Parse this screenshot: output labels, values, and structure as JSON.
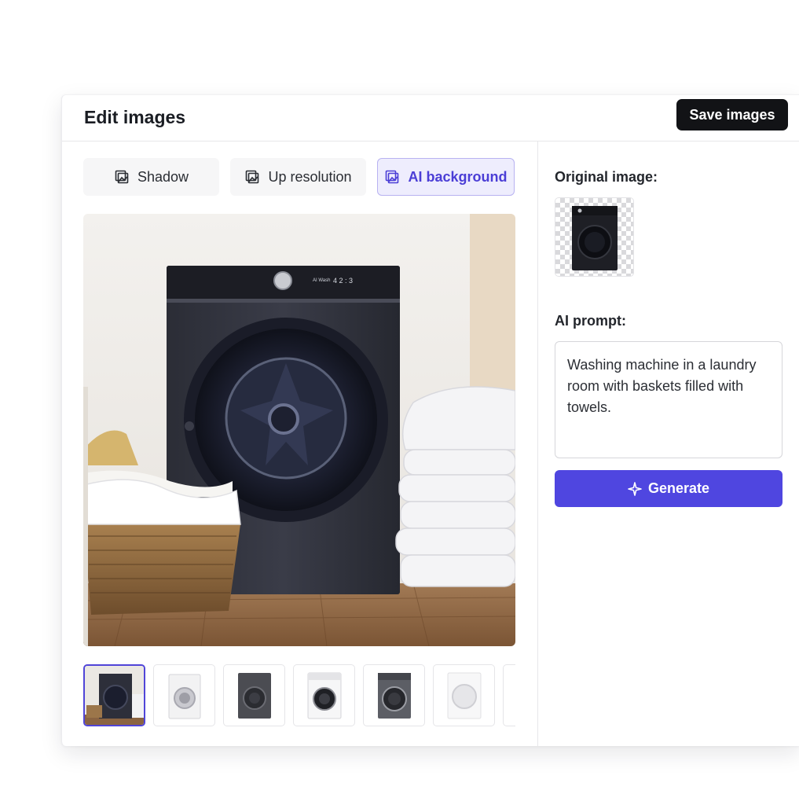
{
  "header": {
    "title": "Edit images",
    "save_label": "Save images"
  },
  "tabs": [
    {
      "label": "Shadow",
      "icon": "image-edit-icon",
      "active": false
    },
    {
      "label": "Up resolution",
      "icon": "image-edit-icon",
      "active": false
    },
    {
      "label": "AI background",
      "icon": "image-edit-icon",
      "active": true
    }
  ],
  "panel": {
    "original_label": "Original image:",
    "prompt_label": "AI prompt:",
    "prompt_value": "Washing machine in a laundry room with baskets filled with towels.",
    "generate_label": "Generate",
    "generate_icon": "sparkle-icon"
  },
  "thumbnails": [
    {
      "name": "dark washer in laundry scene",
      "selected": true
    },
    {
      "name": "white front-load washer",
      "selected": false
    },
    {
      "name": "graphite front-load washer",
      "selected": false
    },
    {
      "name": "white washer with dark door",
      "selected": false
    },
    {
      "name": "grey washer",
      "selected": false
    },
    {
      "name": "white dryer",
      "selected": false
    }
  ],
  "colors": {
    "accent": "#4f46e0",
    "accent_soft": "#eeedfd",
    "dark_button": "#121316",
    "selected_border": "#5045d8"
  }
}
